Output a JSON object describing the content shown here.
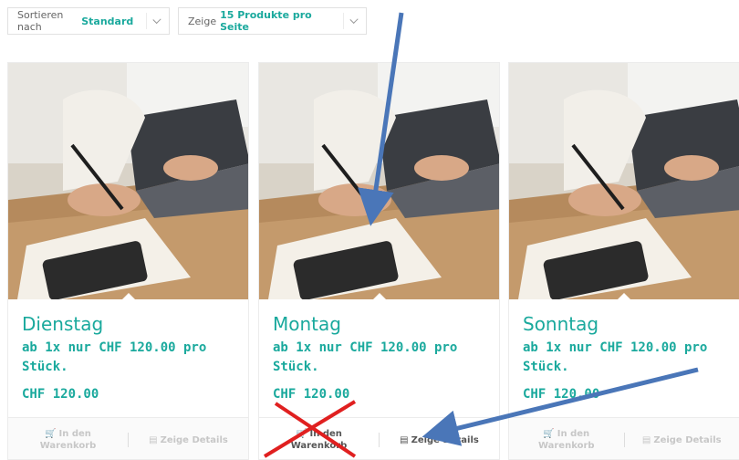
{
  "toolbar": {
    "sort_prefix": "Sortieren nach",
    "sort_value": "Standard",
    "count_prefix": "Zeige",
    "count_value": "15 Produkte pro Seite"
  },
  "products": [
    {
      "title": "Dienstag",
      "subtitle": "ab 1x nur CHF 120.00 pro Stück.",
      "price": "CHF 120.00",
      "cart_label_1": "In den",
      "cart_label_2": "Warenkorb",
      "details_label": "Zeige Details"
    },
    {
      "title": "Montag",
      "subtitle": "ab 1x nur CHF 120.00 pro Stück.",
      "price": "CHF 120.00",
      "cart_label_1": "In den",
      "cart_label_2": "Warenkorb",
      "details_label": "Zeige Details"
    },
    {
      "title": "Sonntag",
      "subtitle": "ab 1x nur CHF 120.00 pro Stück.",
      "price": "CHF 120.00",
      "cart_label_1": "In den",
      "cart_label_2": "Warenkorb",
      "details_label": "Zeige Details"
    }
  ],
  "colors": {
    "accent": "#1aa99d",
    "annotation_arrow": "#4a76b8",
    "annotation_cross": "#e02020"
  },
  "icons": [
    "cart-icon",
    "document-icon",
    "chevron-down-icon"
  ]
}
